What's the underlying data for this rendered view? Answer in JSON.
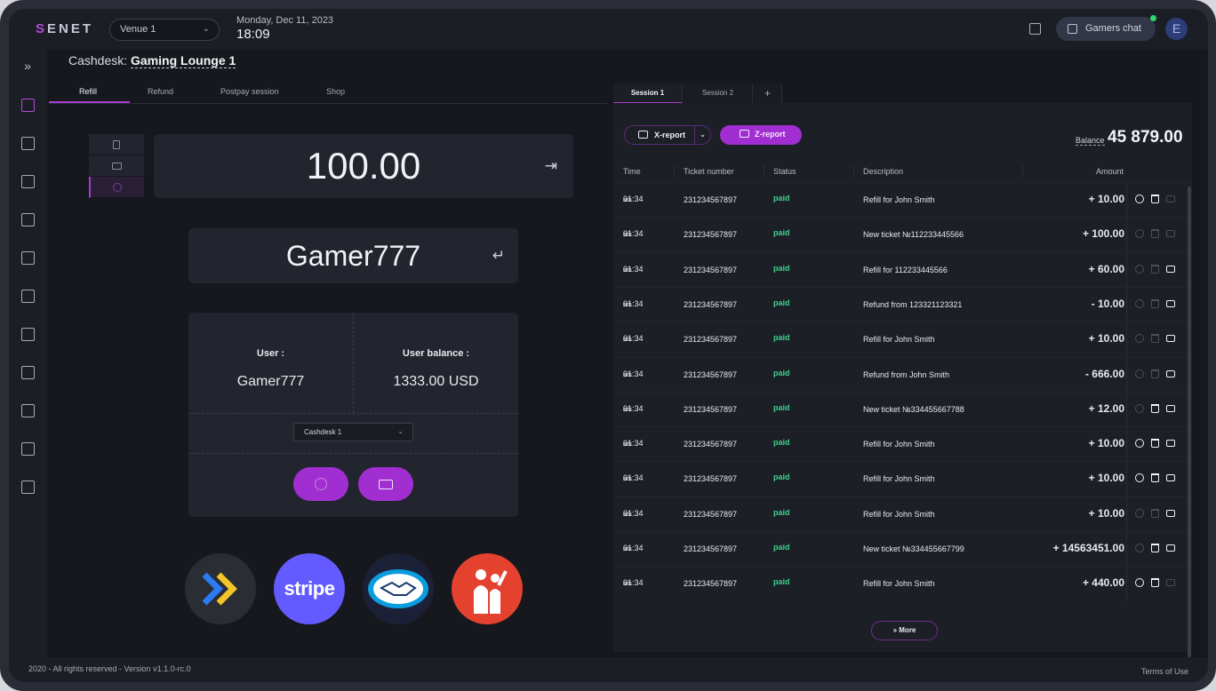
{
  "app": {
    "logo": "SENET",
    "venue": "Venue 1",
    "date": "Monday, Dec 11, 2023",
    "time": "18:09",
    "chat_label": "Gamers chat",
    "avatar_initial": "E"
  },
  "breadcrumb": {
    "prefix": "Cashdesk:",
    "location": "Gaming Lounge 1"
  },
  "tabs": [
    "Refill",
    "Refund",
    "Postpay session",
    "Shop"
  ],
  "refill": {
    "amount": "100.00",
    "username": "Gamer777",
    "user_label": "User :",
    "user_value": "Gamer777",
    "balance_label": "User balance :",
    "balance_value": "1333.00 USD",
    "cashdesk": "Cashdesk 1"
  },
  "providers": [
    "paydroid-logo",
    "stripe",
    "mercadopago-logo",
    "cashless-logo"
  ],
  "providers_text": {
    "stripe": "stripe"
  },
  "session_tabs": [
    "Session 1",
    "Session 2",
    "+"
  ],
  "reports": {
    "x": "X-report",
    "z": "Z-report",
    "balance_label": "Balance",
    "balance_value": "45 879.00"
  },
  "table": {
    "headers": [
      "Time",
      "Ticket number",
      "Status",
      "Description",
      "Amount"
    ],
    "rows": [
      {
        "time": "01:34",
        "ampm": "am",
        "ticket": "231234567897",
        "status": "paid",
        "desc": "Refill for John Smith",
        "amount": "+ 10.00"
      },
      {
        "time": "01:34",
        "ampm": "am",
        "ticket": "231234567897",
        "status": "paid",
        "desc": "New ticket №112233445566",
        "amount": "+ 100.00"
      },
      {
        "time": "01:34",
        "ampm": "am",
        "ticket": "231234567897",
        "status": "paid",
        "desc": "Refill for 112233445566",
        "amount": "+ 60.00"
      },
      {
        "time": "01:34",
        "ampm": "am",
        "ticket": "231234567897",
        "status": "paid",
        "desc": "Refund from 123321123321",
        "amount": "- 10.00"
      },
      {
        "time": "01:34",
        "ampm": "am",
        "ticket": "231234567897",
        "status": "paid",
        "desc": "Refill for John Smith",
        "amount": "+ 10.00"
      },
      {
        "time": "01:34",
        "ampm": "am",
        "ticket": "231234567897",
        "status": "paid",
        "desc": "Refund from John Smith",
        "amount": "- 666.00"
      },
      {
        "time": "01:34",
        "ampm": "am",
        "ticket": "231234567897",
        "status": "paid",
        "desc": "New ticket №334455667788",
        "amount": "+ 12.00"
      },
      {
        "time": "01:34",
        "ampm": "am",
        "ticket": "231234567897",
        "status": "paid",
        "desc": "Refill for John Smith",
        "amount": "+ 10.00"
      },
      {
        "time": "01:34",
        "ampm": "am",
        "ticket": "231234567897",
        "status": "paid",
        "desc": "Refill for John Smith",
        "amount": "+ 10.00"
      },
      {
        "time": "01:34",
        "ampm": "am",
        "ticket": "231234567897",
        "status": "paid",
        "desc": "Refill for John Smith",
        "amount": "+ 10.00"
      },
      {
        "time": "01:34",
        "ampm": "am",
        "ticket": "231234567897",
        "status": "paid",
        "desc": "New ticket №334455667799",
        "amount": "+ 14563451.00"
      },
      {
        "time": "01:34",
        "ampm": "am",
        "ticket": "231234567897",
        "status": "paid",
        "desc": "Refill for John Smith",
        "amount": "+ 440.00"
      }
    ],
    "actions_enabled": [
      [
        true,
        true,
        false
      ],
      [
        false,
        false,
        false
      ],
      [
        false,
        false,
        true
      ],
      [
        false,
        false,
        true
      ],
      [
        false,
        false,
        true
      ],
      [
        false,
        false,
        true
      ],
      [
        false,
        true,
        true
      ],
      [
        true,
        true,
        true
      ],
      [
        true,
        true,
        true
      ],
      [
        false,
        false,
        true
      ],
      [
        false,
        true,
        true
      ],
      [
        true,
        true,
        false
      ]
    ],
    "more_label": "More"
  },
  "footer": {
    "copyright": "2020 - All rights reserved - Version v1.1.0-rc.0",
    "terms": "Terms of Use"
  },
  "colors": {
    "accent": "#a12ed1",
    "paid": "#3ed28e",
    "background": "#16181d"
  }
}
